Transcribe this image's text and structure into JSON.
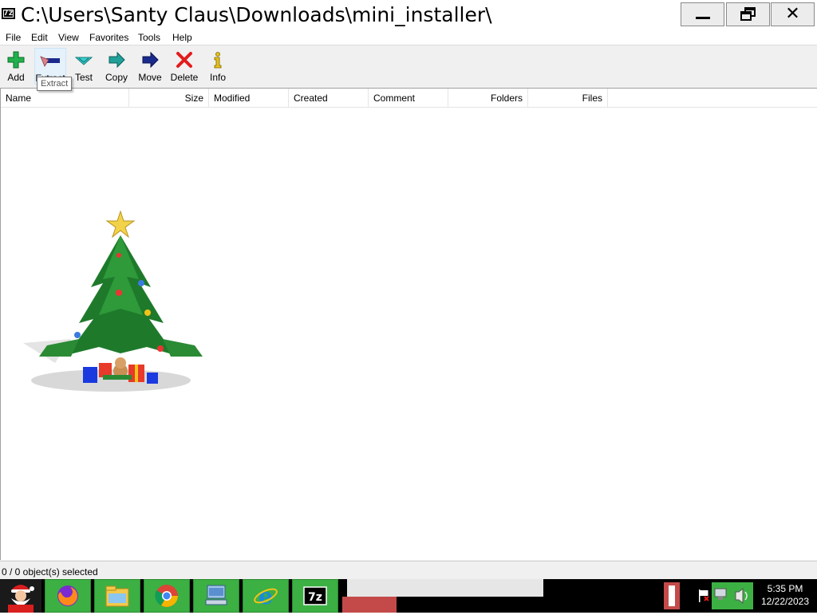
{
  "window": {
    "icon_text": "7z",
    "title": "C:\\Users\\Santy Claus\\Downloads\\mini_installer\\"
  },
  "menu": [
    "File",
    "Edit",
    "View",
    "Favorites",
    "Tools",
    "Help"
  ],
  "toolbar": {
    "add": "Add",
    "extract": "Extract",
    "test": "Test",
    "copy": "Copy",
    "move": "Move",
    "delete": "Delete",
    "info": "Info",
    "tooltip": "Extract"
  },
  "columns": [
    "Name",
    "Size",
    "Modified",
    "Created",
    "Comment",
    "Folders",
    "Files"
  ],
  "rows": [],
  "status": {
    "text": "0 / 0 object(s) selected"
  },
  "taskbar": {
    "icons": [
      "santa-start-icon",
      "firefox-icon",
      "file-explorer-icon",
      "chrome-icon",
      "control-panel-icon",
      "internet-explorer-icon",
      "7zip-icon"
    ],
    "clock_time": "5:35 PM",
    "clock_date": "12/22/2023"
  },
  "colors": {
    "taskbar_green": "#3cb043",
    "taskbar_red": "#c44a4a",
    "add_green": "#22b14c",
    "delete_red": "#e31b1b",
    "move_blue": "#1a2a8c",
    "copy_teal": "#21a09a"
  }
}
